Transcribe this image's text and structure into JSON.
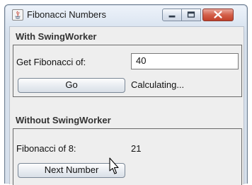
{
  "window": {
    "title": "Fibonacci Numbers",
    "icon": "java-app-icon",
    "controls": [
      "minimize-icon",
      "maximize-icon",
      "close-icon"
    ]
  },
  "with_swingworker": {
    "heading": "With SwingWorker",
    "input_label": "Get Fibonacci of:",
    "input_value": "40",
    "go_label": "Go",
    "status": "Calculating..."
  },
  "without_swingworker": {
    "heading": "Without SwingWorker",
    "result_label": "Fibonacci of 8:",
    "result_value": "21",
    "next_label": "Next Number"
  },
  "colors": {
    "close_button": "#c0402a",
    "titlebar": "#dbe5f1",
    "panel_border": "#6a6a6a"
  }
}
